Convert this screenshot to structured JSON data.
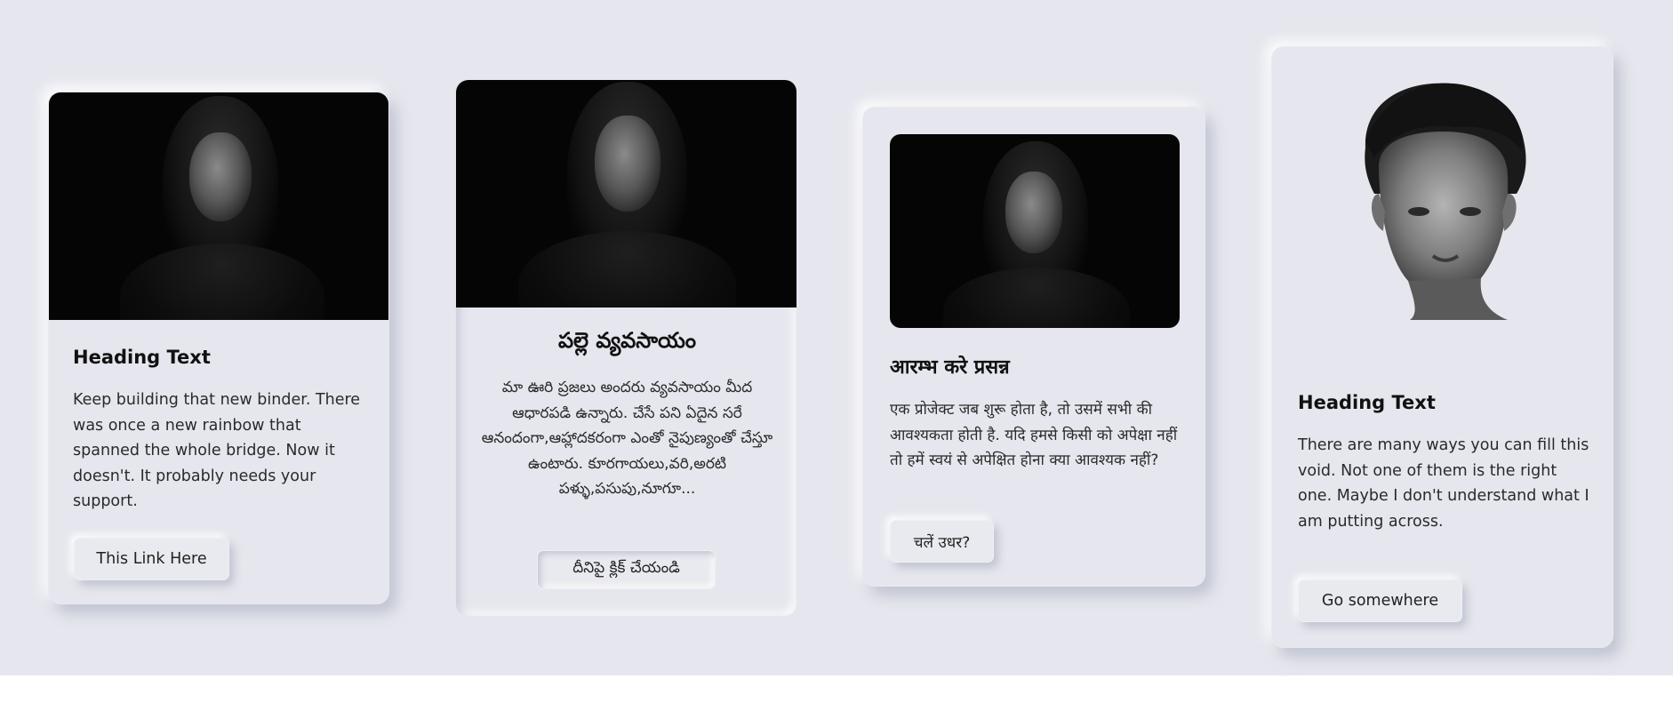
{
  "cards": [
    {
      "heading": "Heading Text",
      "body": "Keep building that new binder. There was once a new rainbow that spanned the whole bridge. Now it doesn't. It probably needs your support.",
      "button": "This Link Here"
    },
    {
      "heading": "పల్లె వ్యవసాయం",
      "body": "మా ఊరి ప్రజలు అందరు వ్యవసాయం మీద ఆధారపడి ఉన్నారు. చేసే పని ఏదైన సరే ఆనందంగా,ఆహ్లాదకరంగా ఎంతో నైపుణ్యంతో చేస్తూ ఉంటారు. కూరగాయలు,వరి,అరటి పళ్ళు,పసుపు,నూగూ...",
      "button": "దీనిపై క్లిక్ చేయండి"
    },
    {
      "heading": "आरम्भ करे प्रसन्न",
      "body": "एक प्रोजेक्ट जब शुरू होता है, तो उसमें सभी की आवश्यकता होती है. यदि हमसे किसी को अपेक्षा नहीं तो हमें स्वयं से अपेक्षित होना क्या आवश्यक नहीं?",
      "button": "चलें उधर?"
    },
    {
      "heading": "Heading Text",
      "body": "There are many ways you can fill this void. Not one of them is the right one. Maybe I don't understand what I am putting across.",
      "button": "Go somewhere"
    }
  ],
  "colors": {
    "background": "#e6e7ee",
    "text": "#1c1c1c"
  },
  "icons": {
    "card1": "portrait-photo",
    "card2": "portrait-photo",
    "card3": "portrait-photo",
    "card4": "portrait-cutout-photo"
  }
}
